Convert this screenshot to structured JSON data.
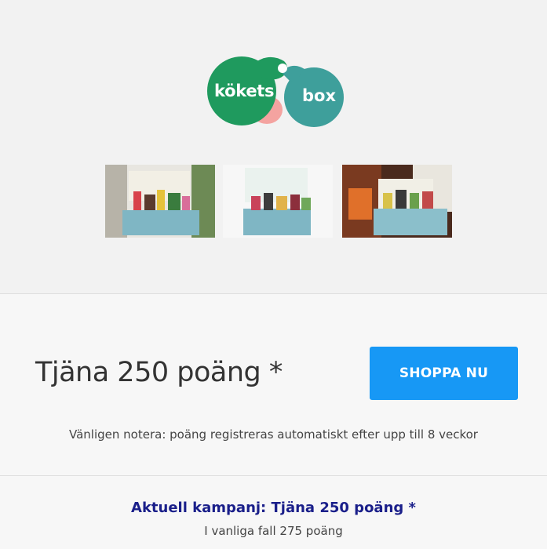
{
  "brand": {
    "logo_word_1": "kökets",
    "logo_word_2": "box",
    "green": "#1f9a5e",
    "teal": "#3e9f9b",
    "pink": "#f4a3a0"
  },
  "gallery": {
    "images": [
      "box-photo-1",
      "box-photo-2",
      "box-photo-3"
    ]
  },
  "offer": {
    "earn_text": "Tjäna 250 poäng *",
    "cta_label": "SHOPPA NU",
    "cta_color": "#1798f5",
    "note": "Vänligen notera: poäng registreras automatiskt efter upp till 8 veckor"
  },
  "campaign": {
    "title": "Aktuell kampanj: Tjäna 250 poäng *",
    "subtitle": "I vanliga fall 275 poäng"
  }
}
